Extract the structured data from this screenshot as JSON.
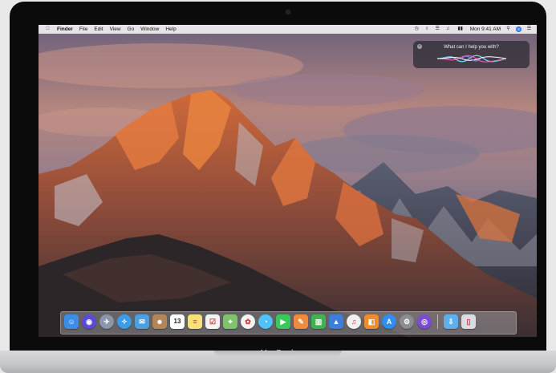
{
  "device": {
    "brand": "MacBook"
  },
  "menubar": {
    "apple_icon": "apple-icon",
    "app_name": "Finder",
    "menus": [
      "File",
      "Edit",
      "View",
      "Go",
      "Window",
      "Help"
    ],
    "clock": "Mon 9:41 AM",
    "status_icons": [
      "time-machine-icon",
      "bluetooth-icon",
      "wifi-icon",
      "volume-icon",
      "battery-icon",
      "search-icon",
      "siri-icon",
      "notification-center-icon"
    ]
  },
  "siri": {
    "prompt": "What can I help you with?"
  },
  "dock": {
    "apps": [
      {
        "name": "finder",
        "color": "#3a8ee6"
      },
      {
        "name": "siri",
        "color": "#5b4bd6"
      },
      {
        "name": "launchpad",
        "color": "#8b96a8"
      },
      {
        "name": "safari",
        "color": "#3c9ce8"
      },
      {
        "name": "mail",
        "color": "#4aa0e0"
      },
      {
        "name": "contacts",
        "color": "#b3865a"
      },
      {
        "name": "calendar",
        "color": "#ffffff",
        "label": "13"
      },
      {
        "name": "notes",
        "color": "#f5e27a"
      },
      {
        "name": "reminders",
        "color": "#f4f4f4"
      },
      {
        "name": "maps",
        "color": "#7fc36f"
      },
      {
        "name": "photos",
        "color": "#f2f2f2"
      },
      {
        "name": "messages",
        "color": "#4fc3f7"
      },
      {
        "name": "facetime",
        "color": "#3bc85a"
      },
      {
        "name": "pages",
        "color": "#f08b3e"
      },
      {
        "name": "numbers",
        "color": "#3fb34f"
      },
      {
        "name": "keynote",
        "color": "#3d7fd8"
      },
      {
        "name": "itunes",
        "color": "#f0f0f0"
      },
      {
        "name": "ibooks",
        "color": "#f08b2e"
      },
      {
        "name": "app-store",
        "color": "#2f8ff0"
      },
      {
        "name": "system-preferences",
        "color": "#8b8d93"
      },
      {
        "name": "itunes-u",
        "color": "#7a4cd6"
      }
    ],
    "right": [
      {
        "name": "downloads-folder",
        "color": "#5fb0ea"
      },
      {
        "name": "trash",
        "color": "#d9dde3"
      }
    ]
  }
}
